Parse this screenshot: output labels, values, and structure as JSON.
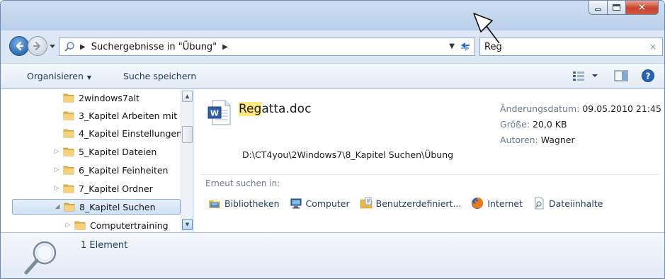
{
  "window": {
    "caption_icons": [
      "minimize-icon",
      "maximize-icon",
      "close-icon"
    ]
  },
  "address_bar": {
    "breadcrumb_label": "Suchergebnisse in \"Übung\"",
    "icons": [
      "search-icon",
      "chevron-down-icon",
      "refresh-icon"
    ]
  },
  "search": {
    "value": "Reg",
    "clear_glyph": "×"
  },
  "toolbar": {
    "organize_label": "Organisieren",
    "save_search_label": "Suche speichern",
    "icons": [
      "view-options-icon",
      "preview-pane-icon",
      "help-icon"
    ]
  },
  "navigation": {
    "items": [
      {
        "label": "2windows7alt",
        "expander": "",
        "selected": false
      },
      {
        "label": "3_Kapitel  Arbeiten mit",
        "expander": "",
        "selected": false
      },
      {
        "label": "4_Kapitel  Einstellungen",
        "expander": "",
        "selected": false
      },
      {
        "label": "5_Kapitel  Dateien",
        "expander": "▷",
        "selected": false
      },
      {
        "label": "6_Kapitel  Feinheiten",
        "expander": "▷",
        "selected": false
      },
      {
        "label": "7_Kapitel  Ordner",
        "expander": "▷",
        "selected": false
      },
      {
        "label": "8_Kapitel  Suchen",
        "expander": "◢",
        "selected": true
      },
      {
        "label": "Computertraining",
        "expander": "▷",
        "selected": false
      }
    ]
  },
  "result": {
    "name_highlight": "Reg",
    "name_rest": "atta.doc",
    "path": "D:\\CT4you\\2Windows7\\8_Kapitel  Suchen\\Übung",
    "modified_label": "Änderungsdatum:",
    "modified_value": "09.05.2010 21:45",
    "size_label": "Größe:",
    "size_value": "20,0 KB",
    "authors_label": "Autoren:",
    "authors_value": "Wagner"
  },
  "search_again": {
    "label": "Erneut suchen in:",
    "locations": [
      {
        "label": "Bibliotheken",
        "icon": "libraries-icon"
      },
      {
        "label": "Computer",
        "icon": "computer-icon"
      },
      {
        "label": "Benutzerdefiniert...",
        "icon": "custom-folder-icon"
      },
      {
        "label": "Internet",
        "icon": "firefox-icon"
      },
      {
        "label": "Dateiinhalte",
        "icon": "file-contents-icon"
      }
    ]
  },
  "details": {
    "count_label": "1 Element"
  },
  "colors": {
    "accent": "#1e3959",
    "highlight": "#ffe97a",
    "frame": "#dbe7f5",
    "close_button": "#c8432b"
  }
}
